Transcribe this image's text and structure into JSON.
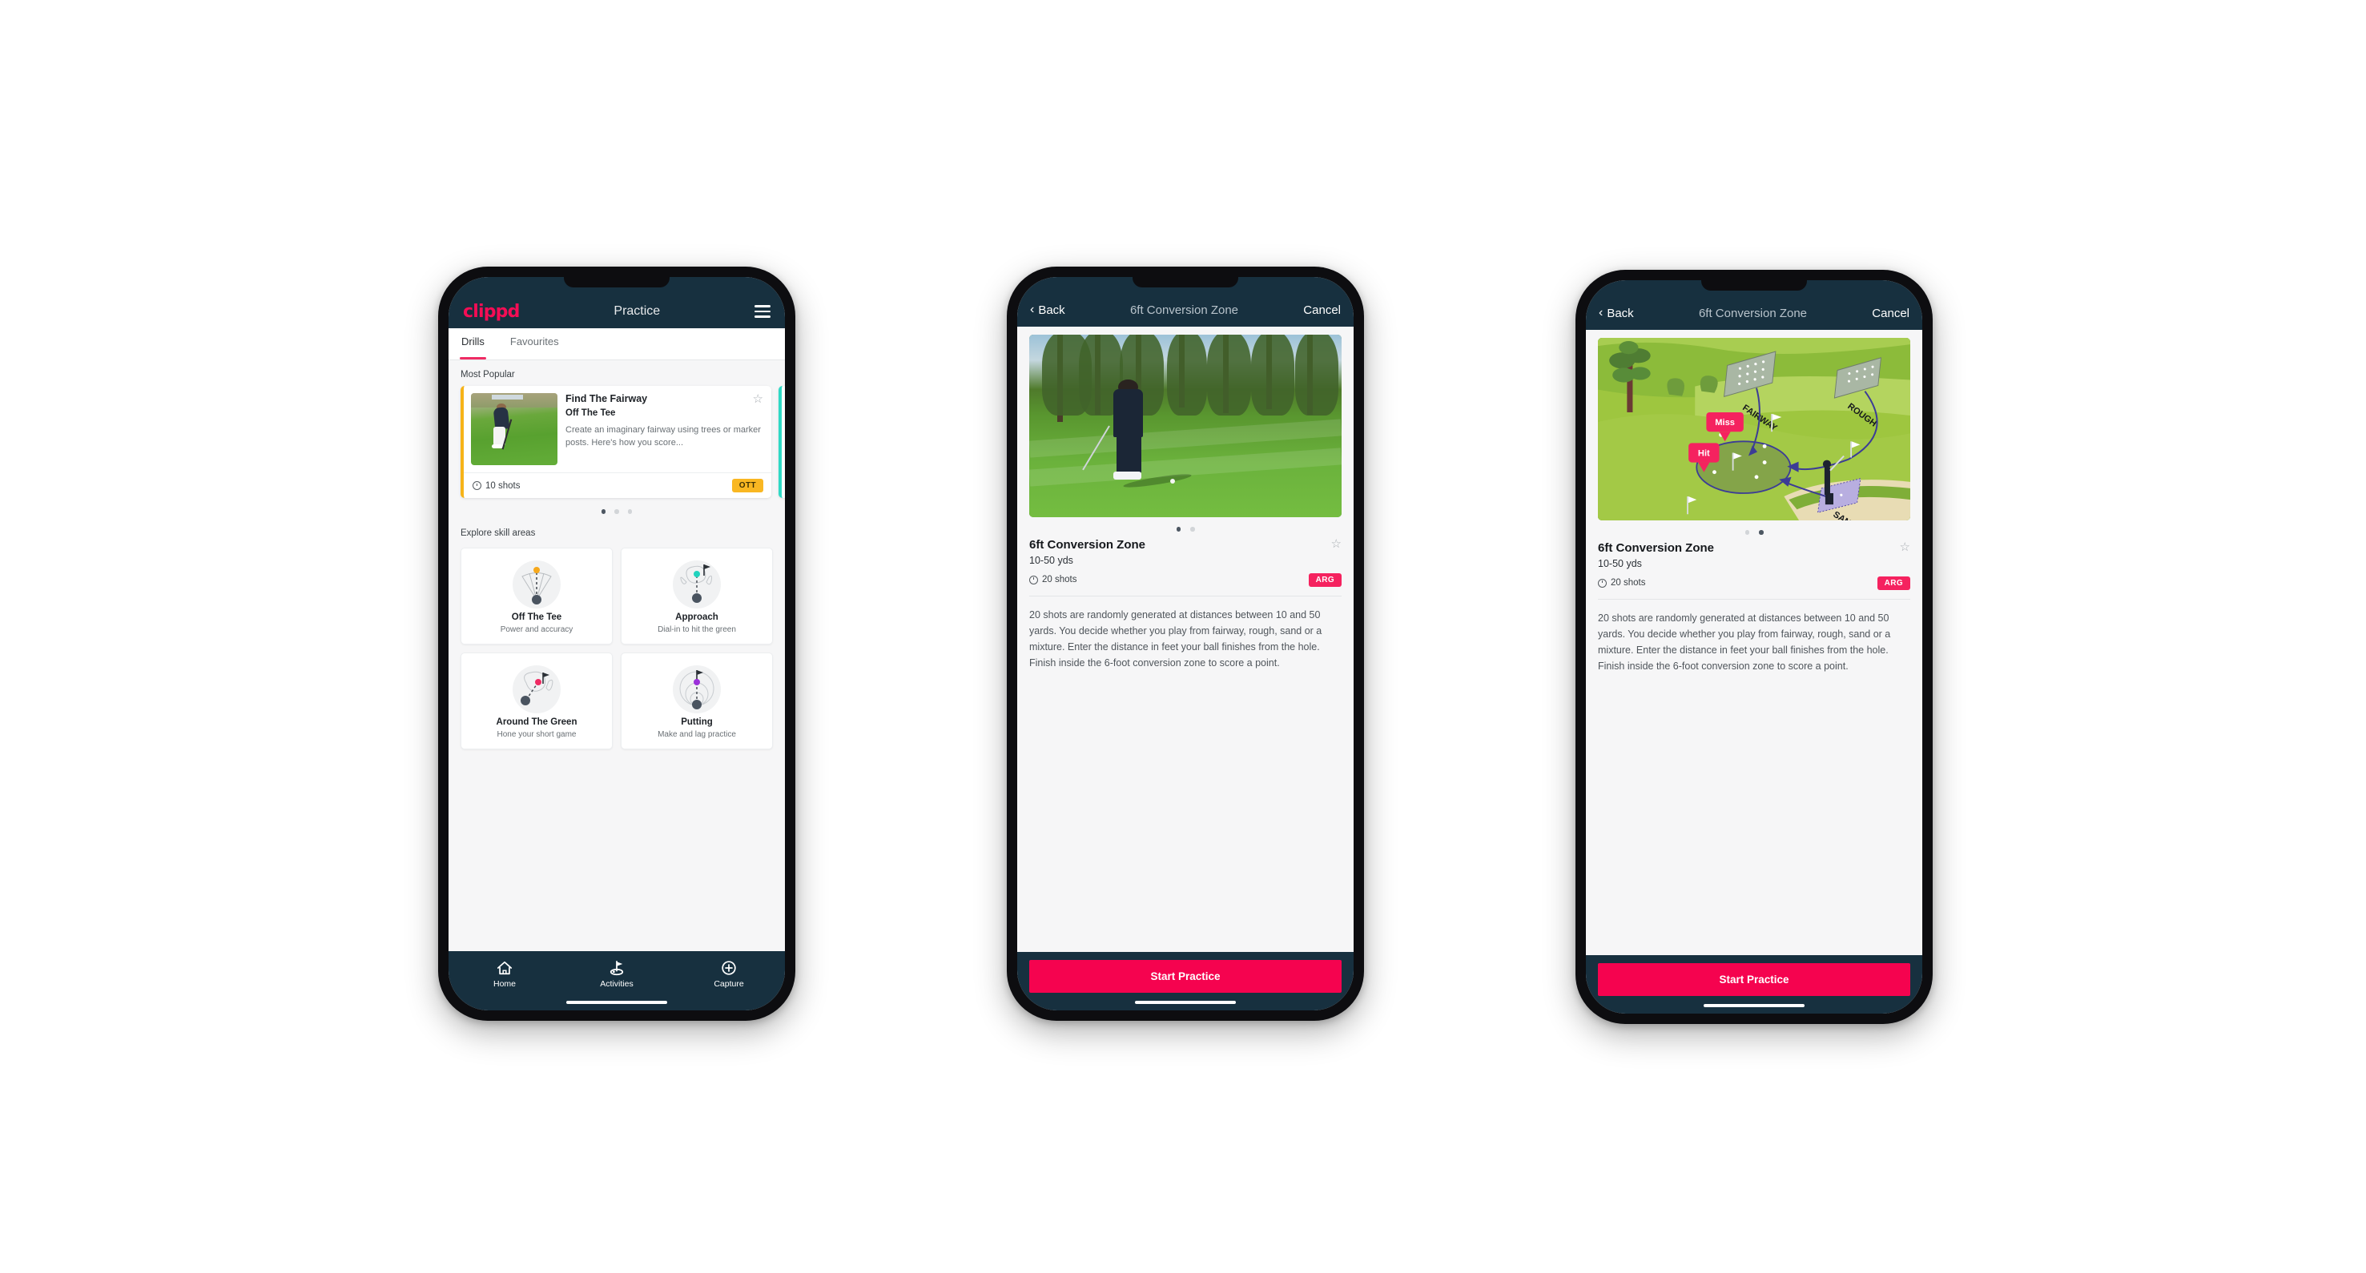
{
  "phones": {
    "practice": {
      "header": {
        "logo": "clippd",
        "title": "Practice",
        "menu_icon": "hamburger-icon"
      },
      "tabs": [
        {
          "label": "Drills",
          "active": true
        },
        {
          "label": "Favourites",
          "active": false
        }
      ],
      "sections": {
        "most_popular_title": "Most Popular",
        "explore_title": "Explore skill areas"
      },
      "featured_drill": {
        "name": "Find The Fairway",
        "category": "Off The Tee",
        "description": "Create an imaginary fairway using trees or marker posts. Here's how you score...",
        "shots": "10 shots",
        "badge": "OTT",
        "badge_color": "#f9b722",
        "accent_color": "#f6b318",
        "next_accent_color": "#2fd9c5",
        "favourite_icon": "star-outline-icon"
      },
      "carousel_dots": {
        "count": 3,
        "active": 0
      },
      "skill_areas": [
        {
          "name": "Off The Tee",
          "desc": "Power and accuracy",
          "icon": "tee-fan-icon",
          "dot_color": "#f6a81c"
        },
        {
          "name": "Approach",
          "desc": "Dial-in to hit the green",
          "icon": "approach-green-icon",
          "dot_color": "#22d3be"
        },
        {
          "name": "Around The Green",
          "desc": "Hone your short game",
          "icon": "chip-green-icon",
          "dot_color": "#ef2b63"
        },
        {
          "name": "Putting",
          "desc": "Make and lag practice",
          "icon": "putting-rings-icon",
          "dot_color": "#9b30d9"
        }
      ],
      "bottom_nav": [
        {
          "label": "Home",
          "icon": "home-icon",
          "active": false
        },
        {
          "label": "Activities",
          "icon": "flag-green-icon",
          "active": true
        },
        {
          "label": "Capture",
          "icon": "plus-circle-icon",
          "active": false
        }
      ]
    },
    "detail_photo": {
      "nav": {
        "back": "Back",
        "title": "6ft Conversion Zone",
        "cancel": "Cancel",
        "back_icon": "chevron-left-icon"
      },
      "hero_type": "photo",
      "dots": {
        "count": 2,
        "active": 0
      },
      "title": "6ft Conversion Zone",
      "distance": "10-50 yds",
      "shots": "20 shots",
      "badge": "ARG",
      "badge_color": "#f5225f",
      "favourite_icon": "star-outline-icon",
      "description": "20 shots are randomly generated at distances between 10 and 50 yards. You decide whether you play from fairway, rough, sand or a mixture. Enter the distance in feet your ball finishes from the hole. Finish inside the 6-foot conversion zone to score a point.",
      "cta": "Start Practice",
      "cta_color": "#f5034f"
    },
    "detail_illustration": {
      "nav": {
        "back": "Back",
        "title": "6ft Conversion Zone",
        "cancel": "Cancel",
        "back_icon": "chevron-left-icon"
      },
      "hero_type": "illustration",
      "illustration_labels": {
        "fairway": "FAIRWAY",
        "rough": "ROUGH",
        "sand": "SAND",
        "miss": "Miss",
        "hit": "Hit"
      },
      "dots": {
        "count": 2,
        "active": 1
      },
      "title": "6ft Conversion Zone",
      "distance": "10-50 yds",
      "shots": "20 shots",
      "badge": "ARG",
      "badge_color": "#f5225f",
      "favourite_icon": "star-outline-icon",
      "description": "20 shots are randomly generated at distances between 10 and 50 yards. You decide whether you play from fairway, rough, sand or a mixture. Enter the distance in feet your ball finishes from the hole. Finish inside the 6-foot conversion zone to score a point.",
      "cta": "Start Practice",
      "cta_color": "#f5034f"
    }
  }
}
